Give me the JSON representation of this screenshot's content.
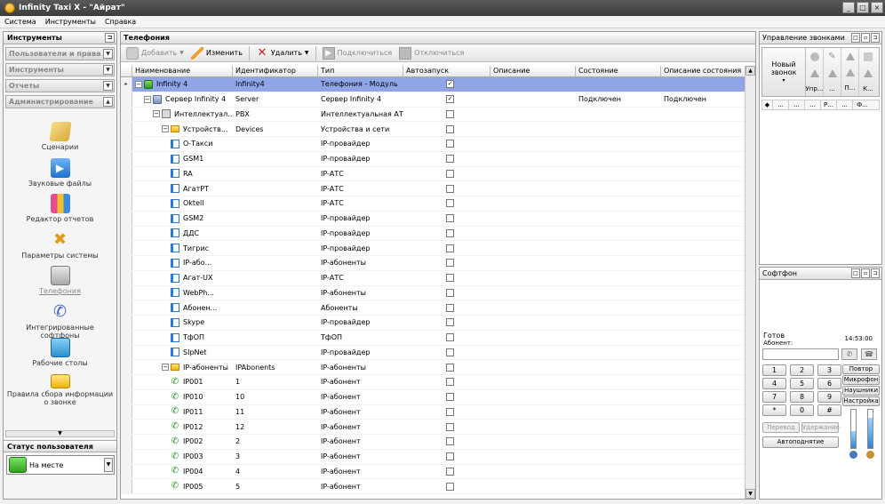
{
  "window": {
    "title": "Infinity Taxi X - \"Айрат\"",
    "min": "_",
    "max": "□",
    "close": "×"
  },
  "menu": [
    "Система",
    "Инструменты",
    "Справка"
  ],
  "left": {
    "header": "Инструменты",
    "sections": [
      "Пользователи и права",
      "Инструменты",
      "Отчеты",
      "Администрирование"
    ],
    "items": [
      {
        "label": "Сценарии",
        "icon": "scroll-icon",
        "color": "#e8c35a"
      },
      {
        "label": "Звуковые файлы",
        "icon": "play-icon",
        "color": "#3a8ae0"
      },
      {
        "label": "Редактор отчетов",
        "icon": "report-editor-icon",
        "color": "#d85a9a"
      },
      {
        "label": "Параметры системы",
        "icon": "tools-icon",
        "color": "#e0a030"
      },
      {
        "label": "Телефония",
        "icon": "telephony-icon",
        "color": "#a0a0a0"
      },
      {
        "label": "Интегрированные софтфоны",
        "icon": "handset-icon",
        "color": "#4a6ad8"
      },
      {
        "label": "Рабочие столы",
        "icon": "desktop-icon",
        "color": "#3aa0d8"
      },
      {
        "label": "Правила сбора информации о звонке",
        "icon": "rules-icon",
        "color": "#f0c030"
      }
    ],
    "status_header": "Статус пользователя",
    "status_value": "На месте"
  },
  "center": {
    "header": "Телефония",
    "toolbar": {
      "add": "Добавить",
      "edit": "Изменить",
      "delete": "Удалить",
      "connect": "Подключиться",
      "disconnect": "Отключиться"
    },
    "columns": [
      "Наименование",
      "Идентификатор",
      "Тип",
      "Автозапуск",
      "Описание",
      "Состояние",
      "Описание состояния"
    ],
    "rows": [
      {
        "name": "Infinity 4",
        "id": "Infinity4",
        "type": "Телефония - Модуль",
        "auto": "✓",
        "state": "",
        "state_desc": ""
      },
      {
        "name": "Сервер Infinity 4",
        "id": "Server",
        "type": "Сервер Infinity 4",
        "auto": "✓",
        "state": "Подключен",
        "state_desc": "Подключен"
      },
      {
        "name": "Интеллектуал...",
        "id": "PBX",
        "type": "Интеллектуальная АТС",
        "auto": "",
        "state": "",
        "state_desc": ""
      },
      {
        "name": "Устройств...",
        "id": "Devices",
        "type": "Устройства и сети",
        "auto": "",
        "state": "",
        "state_desc": ""
      },
      {
        "name": "О-Такси",
        "id": "",
        "type": "IP-провайдер",
        "auto": "",
        "state": "",
        "state_desc": ""
      },
      {
        "name": "GSM1",
        "id": "",
        "type": "IP-провайдер",
        "auto": "",
        "state": "",
        "state_desc": ""
      },
      {
        "name": "RA",
        "id": "",
        "type": "IP-АТС",
        "auto": "",
        "state": "",
        "state_desc": ""
      },
      {
        "name": "АгатРТ",
        "id": "",
        "type": "IP-АТС",
        "auto": "",
        "state": "",
        "state_desc": ""
      },
      {
        "name": "Oktell",
        "id": "",
        "type": "IP-АТС",
        "auto": "",
        "state": "",
        "state_desc": ""
      },
      {
        "name": "GSM2",
        "id": "",
        "type": "IP-провайдер",
        "auto": "",
        "state": "",
        "state_desc": ""
      },
      {
        "name": "ДДС",
        "id": "",
        "type": "IP-провайдер",
        "auto": "",
        "state": "",
        "state_desc": ""
      },
      {
        "name": "Тигрис",
        "id": "",
        "type": "IP-провайдер",
        "auto": "",
        "state": "",
        "state_desc": ""
      },
      {
        "name": "IP-або...",
        "id": "",
        "type": "IP-абоненты",
        "auto": "",
        "state": "",
        "state_desc": ""
      },
      {
        "name": "Агат-UX",
        "id": "",
        "type": "IP-АТС",
        "auto": "",
        "state": "",
        "state_desc": ""
      },
      {
        "name": "WebPh...",
        "id": "",
        "type": "IP-абоненты",
        "auto": "",
        "state": "",
        "state_desc": ""
      },
      {
        "name": "Абонен...",
        "id": "",
        "type": "Абоненты",
        "auto": "",
        "state": "",
        "state_desc": ""
      },
      {
        "name": "Skype",
        "id": "",
        "type": "IP-провайдер",
        "auto": "",
        "state": "",
        "state_desc": ""
      },
      {
        "name": "ТфОП",
        "id": "",
        "type": "ТфОП",
        "auto": "",
        "state": "",
        "state_desc": ""
      },
      {
        "name": "SIpNet",
        "id": "",
        "type": "IP-провайдер",
        "auto": "",
        "state": "",
        "state_desc": ""
      },
      {
        "name": "IP-абоненты",
        "id": "IPAbonents",
        "type": "IP-абоненты",
        "auto": "",
        "state": "",
        "state_desc": ""
      },
      {
        "name": "IP001",
        "id": "1",
        "type": "IP-абонент",
        "auto": "",
        "state": "",
        "state_desc": ""
      },
      {
        "name": "IP010",
        "id": "10",
        "type": "IP-абонент",
        "auto": "",
        "state": "",
        "state_desc": ""
      },
      {
        "name": "IP011",
        "id": "11",
        "type": "IP-абонент",
        "auto": "",
        "state": "",
        "state_desc": ""
      },
      {
        "name": "IP012",
        "id": "12",
        "type": "IP-абонент",
        "auto": "",
        "state": "",
        "state_desc": ""
      },
      {
        "name": "IP002",
        "id": "2",
        "type": "IP-абонент",
        "auto": "",
        "state": "",
        "state_desc": ""
      },
      {
        "name": "IP003",
        "id": "3",
        "type": "IP-абонент",
        "auto": "",
        "state": "",
        "state_desc": ""
      },
      {
        "name": "IP004",
        "id": "4",
        "type": "IP-абонент",
        "auto": "",
        "state": "",
        "state_desc": ""
      },
      {
        "name": "IP005",
        "id": "5",
        "type": "IP-абонент",
        "auto": "",
        "state": "",
        "state_desc": ""
      }
    ]
  },
  "calls": {
    "header": "Управление звонками",
    "new_call": "Новый звонок",
    "cols": [
      "Упр...",
      "...",
      "П...",
      "К..."
    ],
    "table_cols": [
      "◆",
      "...",
      "...",
      "...",
      "Р...",
      "...",
      "Ф..."
    ]
  },
  "softphone": {
    "header": "Софтфон",
    "status": "Готов",
    "subscriber_label": "Абонент:",
    "time": "14:53:00",
    "keys": [
      "1",
      "2",
      "3",
      "4",
      "5",
      "6",
      "7",
      "8",
      "9",
      "*",
      "0",
      "#"
    ],
    "side": [
      "Повтор",
      "Микрофон",
      "Наушники",
      "Настройка"
    ],
    "transfer": "Перевод",
    "hold": "Удержание",
    "autoanswer": "Автоподнятие"
  }
}
